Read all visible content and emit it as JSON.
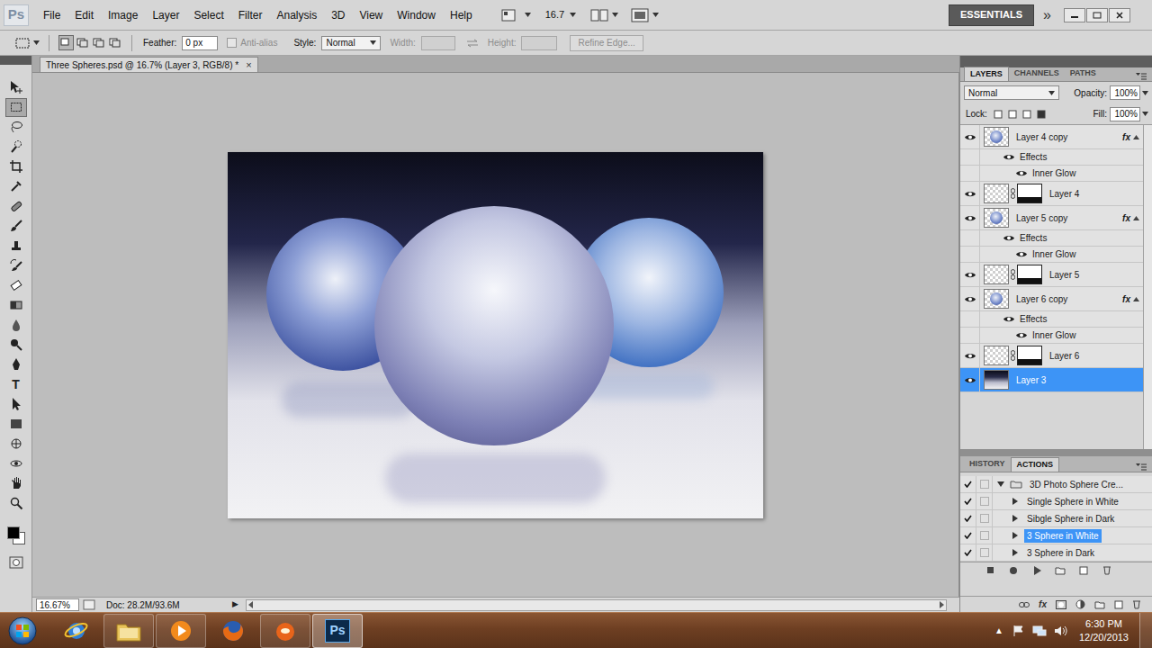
{
  "app": {
    "logo": "Ps"
  },
  "menu": [
    "File",
    "Edit",
    "Image",
    "Layer",
    "Select",
    "Filter",
    "Analysis",
    "3D",
    "View",
    "Window",
    "Help"
  ],
  "app_bar": {
    "zoom": "16.7",
    "workspace": "ESSENTIALS",
    "more": "»"
  },
  "options_bar": {
    "feather_label": "Feather:",
    "feather_value": "0 px",
    "anti_alias": {
      "label": "Anti-alias",
      "checked": false,
      "disabled": true
    },
    "style_label": "Style:",
    "style_value": "Normal",
    "width": {
      "label": "Width:",
      "disabled": true
    },
    "height": {
      "label": "Height:",
      "disabled": true
    },
    "refine_edge": {
      "label": "Refine Edge...",
      "disabled": true
    }
  },
  "tools": [
    {
      "kind": "move",
      "selected": false
    },
    {
      "kind": "marquee",
      "selected": true
    },
    {
      "kind": "lasso",
      "selected": false
    },
    {
      "kind": "quick-select",
      "selected": false
    },
    {
      "kind": "crop",
      "selected": false
    },
    {
      "kind": "eyedropper",
      "selected": false
    },
    {
      "kind": "healing",
      "selected": false
    },
    {
      "kind": "brush",
      "selected": false
    },
    {
      "kind": "stamp",
      "selected": false
    },
    {
      "kind": "history-brush",
      "selected": false
    },
    {
      "kind": "eraser",
      "selected": false
    },
    {
      "kind": "gradient",
      "selected": false
    },
    {
      "kind": "blur",
      "selected": false
    },
    {
      "kind": "dodge",
      "selected": false
    },
    {
      "kind": "pen",
      "selected": false
    },
    {
      "kind": "type",
      "label": "T",
      "selected": false
    },
    {
      "kind": "path-select",
      "selected": false
    },
    {
      "kind": "shape",
      "selected": false
    },
    {
      "kind": "3d-rotate",
      "selected": false
    },
    {
      "kind": "3d-orbit",
      "selected": false
    },
    {
      "kind": "hand",
      "selected": false
    },
    {
      "kind": "zoom",
      "selected": false
    }
  ],
  "colors": {
    "foreground": "#000000",
    "background": "#ffffff"
  },
  "document": {
    "tab": "Three Spheres.psd @ 16.7% (Layer 3, RGB/8) *",
    "close": "×"
  },
  "status_bar": {
    "zoom": "16.67%",
    "doc": "Doc: 28.2M/93.6M",
    "arrow": "▶"
  },
  "layers_panel": {
    "tabs": [
      {
        "label": "LAYERS",
        "selected": true
      },
      {
        "label": "CHANNELS",
        "selected": false
      },
      {
        "label": "PATHS",
        "selected": false
      }
    ],
    "blend_mode": "Normal",
    "opacity_label": "Opacity:",
    "opacity": "100%",
    "lock_label": "Lock:",
    "fill_label": "Fill:",
    "fill": "100%",
    "layers": [
      {
        "kind": "fx-layer",
        "name": "Layer 4 copy",
        "fx": "fx",
        "visible": true,
        "selected": false
      },
      {
        "kind": "effects",
        "name": "Effects",
        "visible": true,
        "selected": false
      },
      {
        "kind": "effect",
        "name": "Inner Glow",
        "visible": true,
        "selected": false
      },
      {
        "kind": "mask-layer",
        "name": "Layer 4",
        "visible": true,
        "selected": false
      },
      {
        "kind": "fx-layer",
        "name": "Layer 5 copy",
        "fx": "fx",
        "visible": true,
        "selected": false
      },
      {
        "kind": "effects",
        "name": "Effects",
        "visible": true,
        "selected": false
      },
      {
        "kind": "effect",
        "name": "Inner Glow",
        "visible": true,
        "selected": false
      },
      {
        "kind": "mask-layer",
        "name": "Layer 5",
        "visible": true,
        "selected": false
      },
      {
        "kind": "fx-layer",
        "name": "Layer 6 copy",
        "fx": "fx",
        "visible": true,
        "selected": false
      },
      {
        "kind": "effects",
        "name": "Effects",
        "visible": true,
        "selected": false
      },
      {
        "kind": "effect",
        "name": "Inner Glow",
        "visible": true,
        "selected": false
      },
      {
        "kind": "mask-layer",
        "name": "Layer 6",
        "visible": true,
        "selected": false
      },
      {
        "kind": "fill-layer",
        "name": "Layer 3",
        "visible": true,
        "selected": true
      }
    ],
    "footer_fx": "fx"
  },
  "actions_panel": {
    "tabs": [
      {
        "label": "HISTORY",
        "selected": false
      },
      {
        "label": "ACTIONS",
        "selected": true
      }
    ],
    "rows": [
      {
        "kind": "set",
        "name": "3D Photo Sphere Cre...",
        "checked": true,
        "expanded": true,
        "selected": false
      },
      {
        "kind": "action",
        "name": "Single Sphere in White",
        "checked": true,
        "expanded": false,
        "selected": false
      },
      {
        "kind": "action",
        "name": "Sibgle Sphere in Dark",
        "checked": true,
        "expanded": false,
        "selected": false
      },
      {
        "kind": "action",
        "name": "3 Sphere in White",
        "checked": true,
        "expanded": false,
        "selected": true
      },
      {
        "kind": "action",
        "name": "3 Sphere in Dark",
        "checked": true,
        "expanded": false,
        "selected": false
      }
    ]
  },
  "taskbar": {
    "apps": [
      {
        "kind": "ie",
        "running": false,
        "active": false
      },
      {
        "kind": "explorer",
        "running": true,
        "active": false
      },
      {
        "kind": "media-player",
        "running": true,
        "active": false
      },
      {
        "kind": "firefox",
        "running": false,
        "active": false
      },
      {
        "kind": "orange-app",
        "running": true,
        "active": false
      },
      {
        "kind": "photoshop",
        "label": "Ps",
        "running": true,
        "active": true
      }
    ],
    "tray_expand": "▲",
    "time": "6:30 PM",
    "date": "12/20/2013"
  }
}
